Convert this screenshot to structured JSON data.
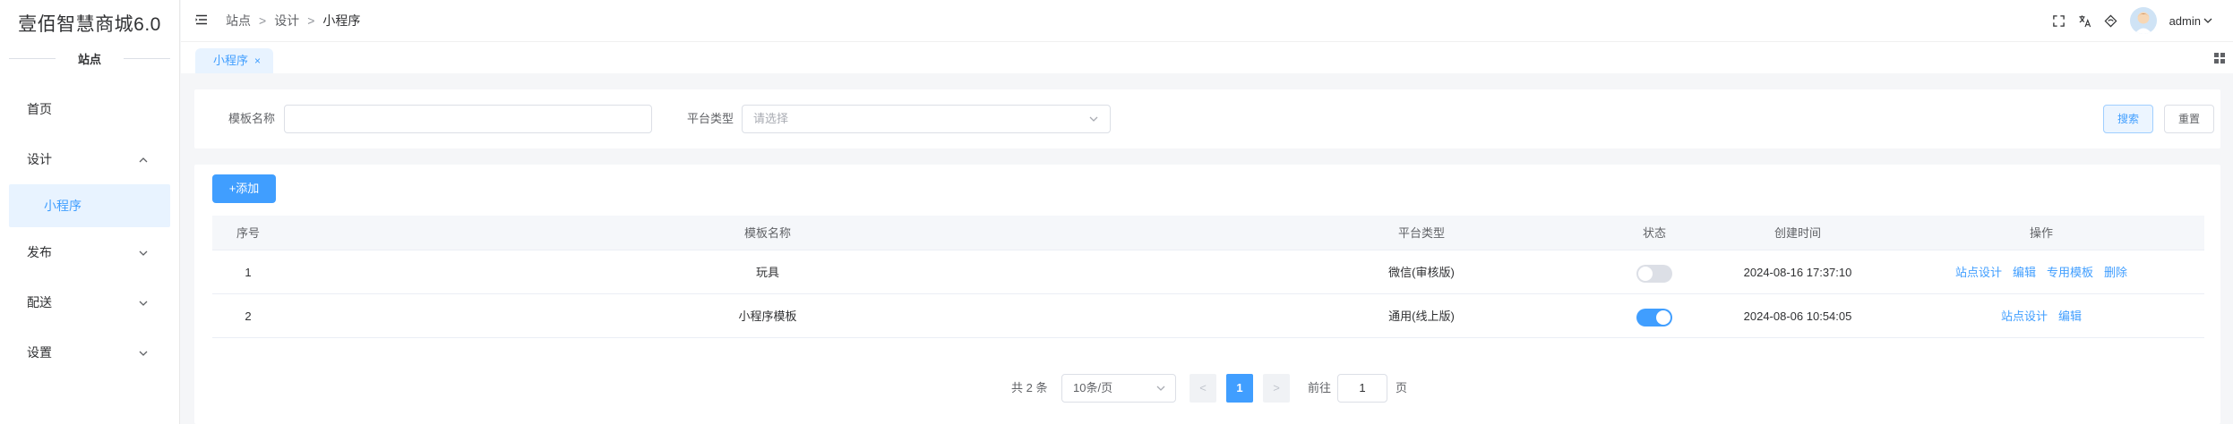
{
  "sidebar": {
    "brand": "壹佰智慧商城6.0",
    "section": "站点",
    "items": [
      {
        "label": "首页"
      },
      {
        "label": "设计"
      },
      {
        "label": "小程序"
      },
      {
        "label": "发布"
      },
      {
        "label": "配送"
      },
      {
        "label": "设置"
      }
    ]
  },
  "header": {
    "breadcrumb": [
      "站点",
      "设计",
      "小程序"
    ],
    "separator": ">",
    "username": "admin"
  },
  "tabs": [
    {
      "label": "小程序",
      "close": "×"
    }
  ],
  "filter": {
    "name_label": "模板名称",
    "name_value": "",
    "platform_label": "平台类型",
    "platform_placeholder": "请选择",
    "search_button": "搜索",
    "reset_button": "重置"
  },
  "toolbar": {
    "add_button": "+添加"
  },
  "table": {
    "columns": [
      "序号",
      "模板名称",
      "平台类型",
      "状态",
      "创建时间",
      "操作"
    ],
    "rows": [
      {
        "index": "1",
        "name": "玩具",
        "platform": "微信(审核版)",
        "status_on": false,
        "created": "2024-08-16 17:37:10",
        "actions": [
          "站点设计",
          "编辑",
          "专用模板",
          "删除"
        ]
      },
      {
        "index": "2",
        "name": "小程序模板",
        "platform": "通用(线上版)",
        "status_on": true,
        "created": "2024-08-06 10:54:05",
        "actions": [
          "站点设计",
          "编辑"
        ]
      }
    ]
  },
  "pagination": {
    "total": "共 2 条",
    "page_size": "10条/页",
    "prev": "<",
    "current": "1",
    "next": ">",
    "goto_label": "前往",
    "goto_value": "1",
    "page_label": "页"
  },
  "colors": {
    "primary": "#409eff",
    "active_bg": "#e8f3ff"
  }
}
